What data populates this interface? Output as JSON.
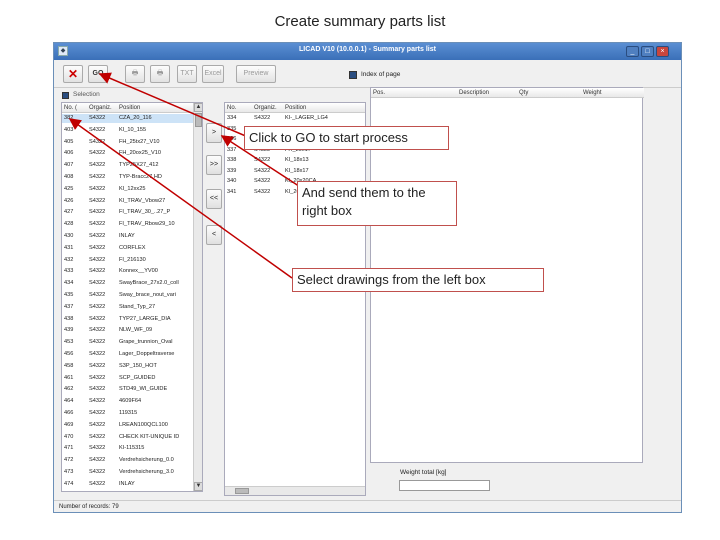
{
  "slide": {
    "title": "Create summary parts list"
  },
  "window": {
    "title": "LICAD V10 (10.0.0.1) - Summary parts list",
    "min": "_",
    "max": "□",
    "close": "×"
  },
  "toolbar": {
    "cancel": "✕",
    "go": "GO",
    "print1": "🖶",
    "print2": "🖶",
    "txt": "TXT",
    "excel": "Excel",
    "preview": "Preview",
    "index_label": "Index of page"
  },
  "left": {
    "selection_label": "Selection",
    "columns": [
      "No. (",
      "Organiz.",
      "Position"
    ],
    "rows": [
      [
        "382",
        "S4322",
        "CZA_20_116"
      ],
      [
        "403",
        "S4322",
        "KI_10_155"
      ],
      [
        "405",
        "S4322",
        "FH_25tx27_V10"
      ],
      [
        "406",
        "S4322",
        "FH_20ox25_V10"
      ],
      [
        "407",
        "S4322",
        "TYP25X27_412"
      ],
      [
        "408",
        "S4322",
        "TYP-Bracc27 HD"
      ],
      [
        "425",
        "S4322",
        "KI_12xx25"
      ],
      [
        "426",
        "S4322",
        "KI_TRAV_Vbow27"
      ],
      [
        "427",
        "S4322",
        "FI_TRAV_30_..27_P"
      ],
      [
        "428",
        "S4322",
        "FI_TRAV_Rbow29_10"
      ],
      [
        "430",
        "S4322",
        "INLAY"
      ],
      [
        "431",
        "S4322",
        "CORFLEX"
      ],
      [
        "432",
        "S4322",
        "FI_216130"
      ],
      [
        "433",
        "S4322",
        "Konnex__YV00"
      ],
      [
        "434",
        "S4322",
        "SwayBrace_27x2.0_coll"
      ],
      [
        "435",
        "S4322",
        "Sway_brace_nout_vari"
      ],
      [
        "437",
        "S4322",
        "Stand_Typ_27"
      ],
      [
        "438",
        "S4322",
        "TYP27_LARGE_DIA"
      ],
      [
        "439",
        "S4322",
        "NLW_WF_09"
      ],
      [
        "453",
        "S4322",
        "Grape_trunnion_Oval"
      ],
      [
        "456",
        "S4322",
        "Lager_Doppeltraverse"
      ],
      [
        "458",
        "S4322",
        "S3P_150_HOT"
      ],
      [
        "461",
        "S4322",
        "SCP_GUIDED"
      ],
      [
        "462",
        "S4322",
        "STD49_WI_GUIDE"
      ],
      [
        "464",
        "S4322",
        "4609F64"
      ],
      [
        "466",
        "S4322",
        "119315"
      ],
      [
        "469",
        "S4322",
        "LREAN100QCL100"
      ],
      [
        "470",
        "S4322",
        "CHECK KIT-UNIQUE ID"
      ],
      [
        "471",
        "S4322",
        "KI-115315"
      ],
      [
        "472",
        "S4322",
        "Verdrehsicherung_0.0"
      ],
      [
        "473",
        "S4322",
        "Verdrehsicherung_3.0"
      ],
      [
        "474",
        "S4322",
        "INLAY"
      ]
    ],
    "count": "Number of records: 79"
  },
  "middle_buttons": [
    ">",
    ">>",
    "<<",
    "<"
  ],
  "center": {
    "columns": [
      "No.",
      "Organiz.",
      "Position"
    ],
    "rows": [
      [
        "334",
        "S4322",
        "KI-_LAGER_LG4"
      ],
      [
        "335",
        "S4322",
        "KI_19x16"
      ],
      [
        "336",
        "S4322",
        "KI_20x17"
      ],
      [
        "337",
        "S4322",
        "FH_20x17"
      ],
      [
        "338",
        "S4322",
        "KI_18x13"
      ],
      [
        "339",
        "S4322",
        "KI_18x17"
      ],
      [
        "340",
        "S4322",
        "KI_20x20CA"
      ],
      [
        "341",
        "S4322",
        "KI_20x13"
      ]
    ]
  },
  "right": {
    "columns": [
      "Pos.",
      "Description",
      "Qty",
      "Weight"
    ],
    "weight_label": "Weight total [kg]",
    "weight_value": ""
  },
  "callouts": {
    "go": "Click to GO to start process",
    "send": "And send them to the right box",
    "select": "Select drawings from the left box"
  },
  "colors": {
    "callout_border": "#c0504d",
    "arrow": "#c00000",
    "titlebar": "#3a6fb8",
    "selection": "#cde3f7"
  }
}
